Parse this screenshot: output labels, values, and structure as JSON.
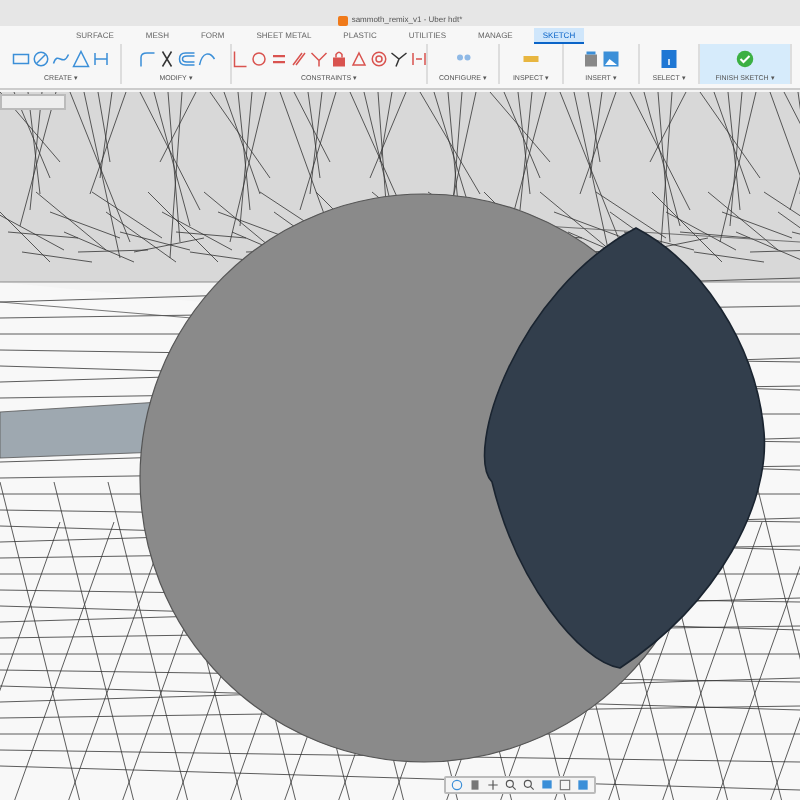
{
  "window": {
    "title": "sammoth_remix_v1 - Uber hdt*"
  },
  "tabs": [
    {
      "label": "SURFACE",
      "selected": false
    },
    {
      "label": "MESH",
      "selected": false
    },
    {
      "label": "FORM",
      "selected": false
    },
    {
      "label": "SHEET METAL",
      "selected": false
    },
    {
      "label": "PLASTIC",
      "selected": false
    },
    {
      "label": "UTILITIES",
      "selected": false
    },
    {
      "label": "MANAGE",
      "selected": false
    },
    {
      "label": "SKETCH",
      "selected": true
    }
  ],
  "groups": [
    {
      "label": "CREATE ▾"
    },
    {
      "label": "MODIFY ▾"
    },
    {
      "label": "CONSTRAINTS ▾"
    },
    {
      "label": "CONFIGURE ▾"
    },
    {
      "label": "INSPECT ▾"
    },
    {
      "label": "INSERT ▾"
    },
    {
      "label": "SELECT ▾"
    },
    {
      "label": "FINISH SKETCH ▾"
    }
  ]
}
